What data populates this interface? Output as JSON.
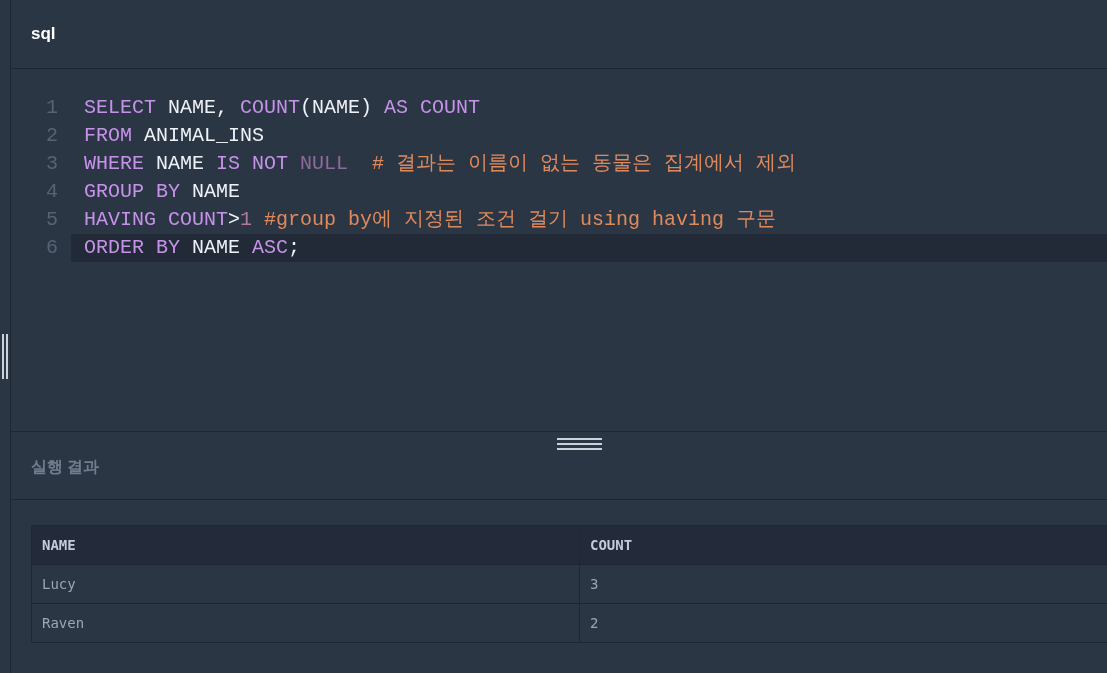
{
  "editor": {
    "title": "sql",
    "lines": [
      {
        "number": "1",
        "active": false,
        "tokens": [
          {
            "text": "SELECT",
            "kind": "keyword"
          },
          {
            "text": " NAME, ",
            "kind": "plain"
          },
          {
            "text": "COUNT",
            "kind": "keyword"
          },
          {
            "text": "(NAME) ",
            "kind": "plain"
          },
          {
            "text": "AS ",
            "kind": "keyword"
          },
          {
            "text": "COUNT",
            "kind": "keyword"
          }
        ]
      },
      {
        "number": "2",
        "active": false,
        "tokens": [
          {
            "text": "FROM",
            "kind": "keyword"
          },
          {
            "text": " ANIMAL_INS",
            "kind": "plain"
          }
        ]
      },
      {
        "number": "3",
        "active": false,
        "tokens": [
          {
            "text": "WHERE",
            "kind": "keyword"
          },
          {
            "text": " NAME ",
            "kind": "plain"
          },
          {
            "text": "IS NOT ",
            "kind": "keyword"
          },
          {
            "text": "NULL",
            "kind": "null"
          },
          {
            "text": "  # 결과는 이름이 없는 동물은 집계에서 제외",
            "kind": "comment"
          }
        ]
      },
      {
        "number": "4",
        "active": false,
        "tokens": [
          {
            "text": "GROUP BY",
            "kind": "keyword"
          },
          {
            "text": " NAME",
            "kind": "plain"
          }
        ]
      },
      {
        "number": "5",
        "active": false,
        "tokens": [
          {
            "text": "HAVING COUNT",
            "kind": "keyword"
          },
          {
            "text": ">",
            "kind": "plain"
          },
          {
            "text": "1",
            "kind": "number"
          },
          {
            "text": " #group by에 지정된 조건 걸기 using having 구문",
            "kind": "comment"
          }
        ]
      },
      {
        "number": "6",
        "active": true,
        "tokens": [
          {
            "text": "ORDER BY",
            "kind": "keyword"
          },
          {
            "text": " NAME ",
            "kind": "plain"
          },
          {
            "text": "ASC",
            "kind": "keyword"
          },
          {
            "text": ";",
            "kind": "plain"
          }
        ]
      }
    ]
  },
  "results": {
    "title": "실행 결과",
    "table": {
      "columns": [
        "NAME",
        "COUNT"
      ],
      "rows": [
        [
          "Lucy",
          "3"
        ],
        [
          "Raven",
          "2"
        ]
      ]
    }
  }
}
